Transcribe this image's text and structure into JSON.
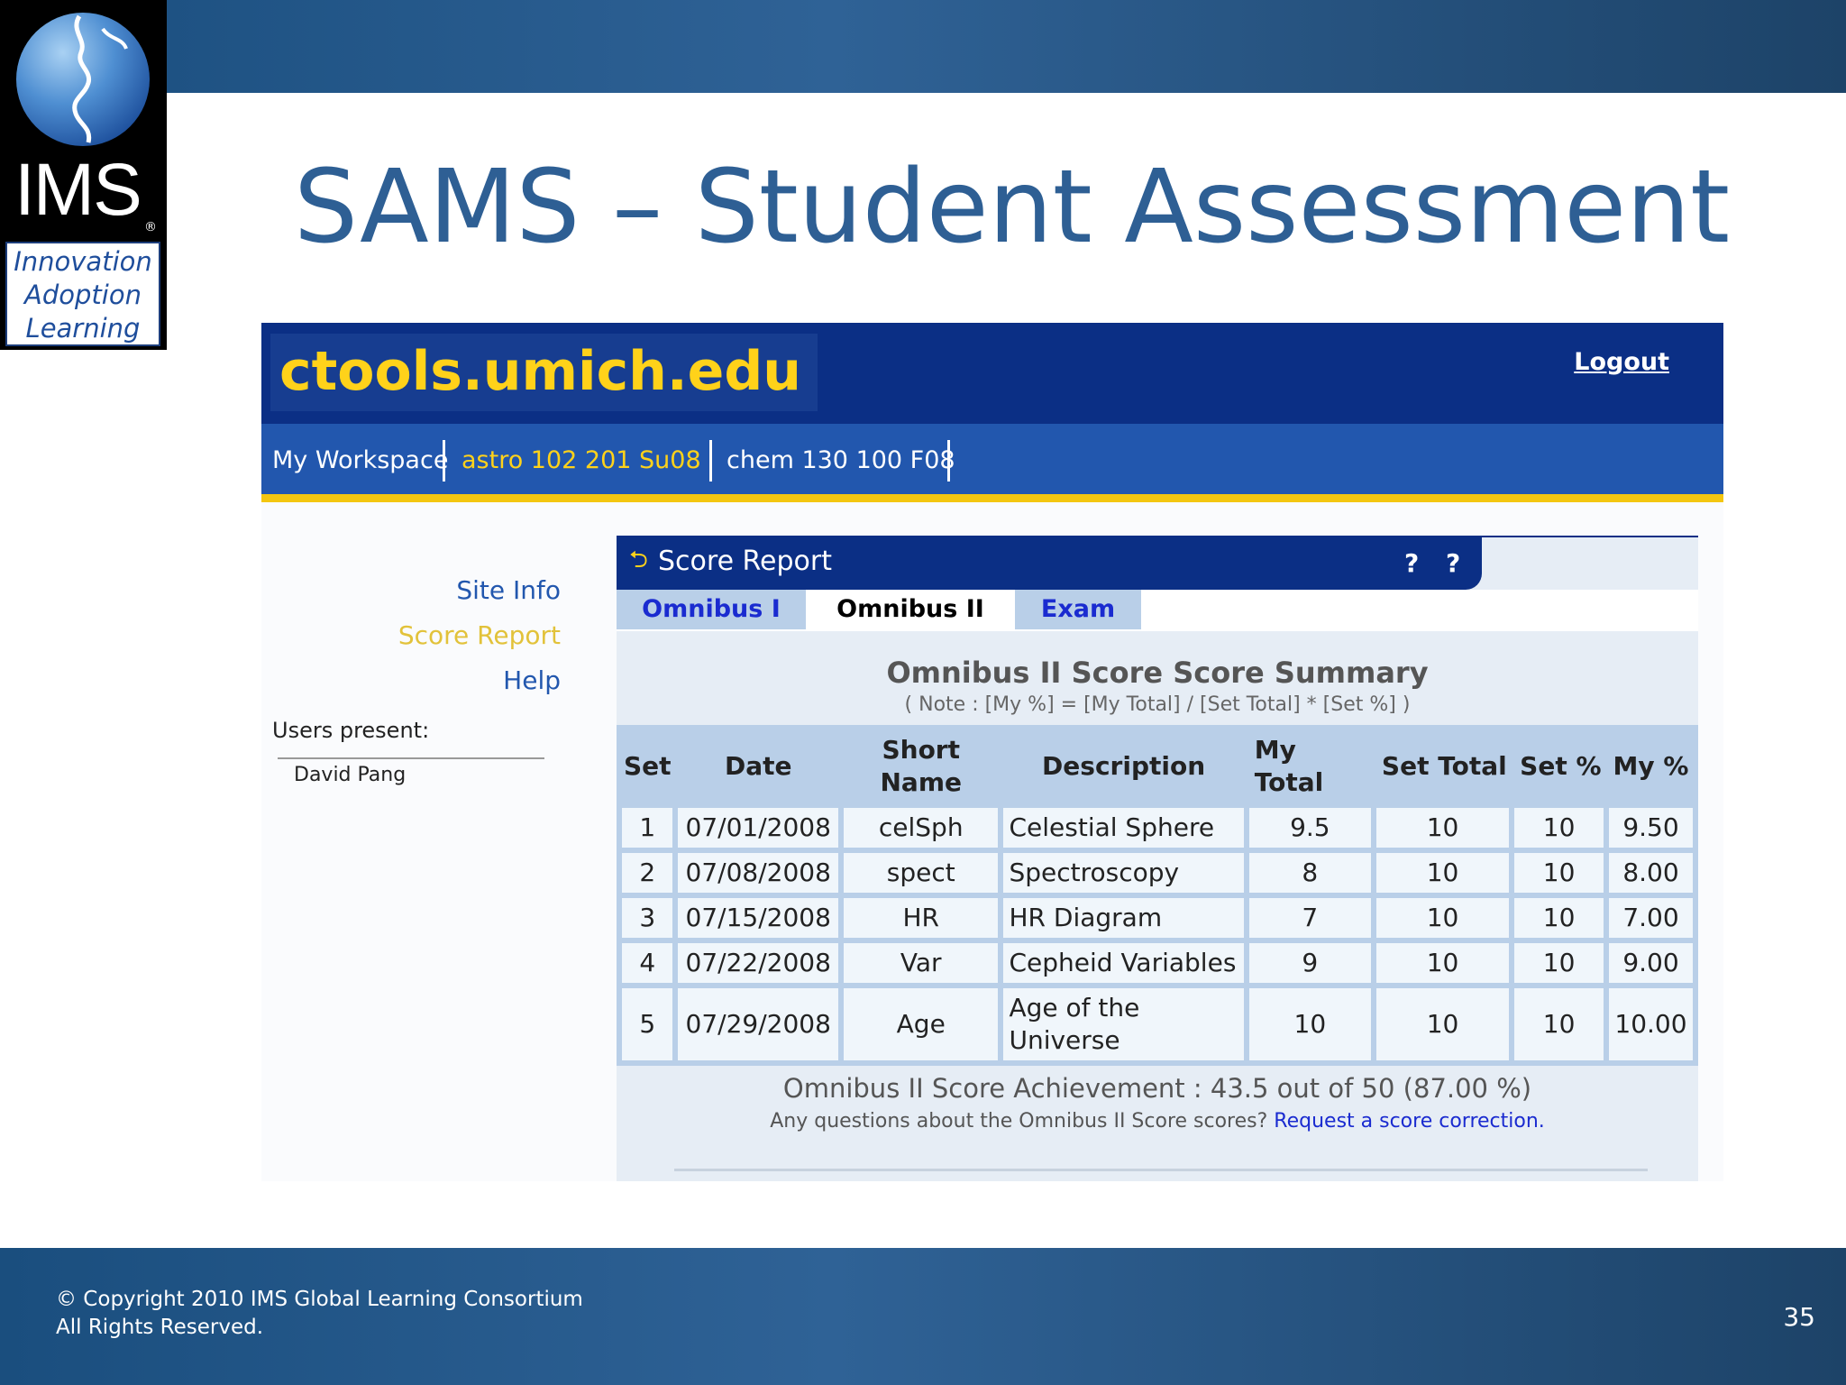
{
  "logo": {
    "name": "IMS",
    "registered": "®",
    "tagline": [
      "Innovation",
      "Adoption",
      "Learning"
    ]
  },
  "slide": {
    "title": "SAMS – Student Assessment",
    "page_number": "35"
  },
  "footer": {
    "copyright_line1": "© Copyright 2010 IMS Global Learning Consortium",
    "copyright_line2": "All Rights Reserved."
  },
  "ctools": {
    "logo": "ctools.umich.edu",
    "logout": "Logout",
    "site_tabs": [
      "My Workspace",
      "astro 102 201 Su08",
      "chem 130 100 F08"
    ],
    "active_site": "astro 102 201 Su08",
    "left_menu": [
      "Site Info",
      "Score Report",
      "Help"
    ],
    "active_menu": "Score Report",
    "users_label": "Users present:",
    "users": [
      "David Pang"
    ]
  },
  "portlet": {
    "title": "Score Report",
    "help_icons": [
      "?",
      "?"
    ],
    "tabs": [
      "Omnibus I",
      "Omnibus II",
      "Exam"
    ],
    "active_tab": "Omnibus II",
    "summary_title": "Omnibus II Score Score Summary",
    "summary_note": "( Note : [My %] = [My Total] / [Set Total] * [Set %] )",
    "columns": [
      "Set",
      "Date",
      "Short Name",
      "Description",
      "My Total",
      "Set Total",
      "Set %",
      "My %"
    ],
    "rows": [
      [
        "1",
        "07/01/2008",
        "celSph",
        "Celestial Sphere",
        "9.5",
        "10",
        "10",
        "9.50"
      ],
      [
        "2",
        "07/08/2008",
        "spect",
        "Spectroscopy",
        "8",
        "10",
        "10",
        "8.00"
      ],
      [
        "3",
        "07/15/2008",
        "HR",
        "HR Diagram",
        "7",
        "10",
        "10",
        "7.00"
      ],
      [
        "4",
        "07/22/2008",
        "Var",
        "Cepheid Variables",
        "9",
        "10",
        "10",
        "9.00"
      ],
      [
        "5",
        "07/29/2008",
        "Age",
        "Age of the Universe",
        "10",
        "10",
        "10",
        "10.00"
      ]
    ],
    "achievement": "Omnibus II Score Achievement : 43.5 out of 50 (87.00 %)",
    "questions_text": "Any questions about the Omnibus II Score scores?",
    "questions_link": "Request a score correction."
  }
}
